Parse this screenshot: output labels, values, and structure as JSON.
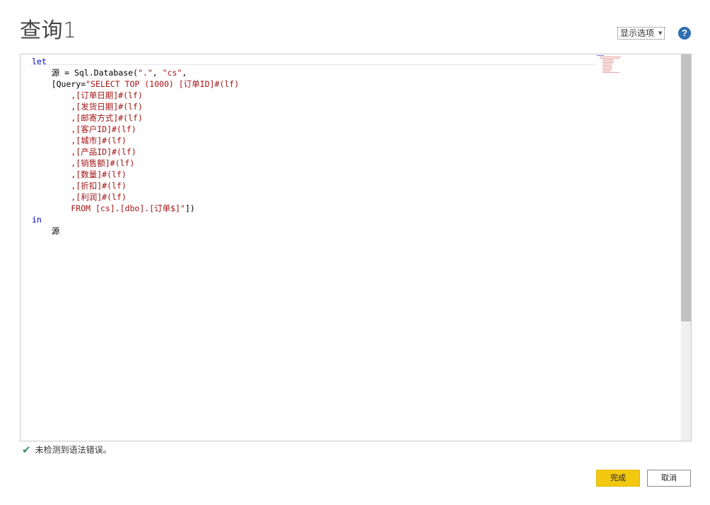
{
  "header": {
    "title": "查询1",
    "display_options_label": "显示选项",
    "display_options_caret": "▼",
    "help_glyph": "?"
  },
  "editor": {
    "lines": [
      [
        {
          "t": "let",
          "c": "kw"
        }
      ],
      [
        {
          "t": "    源 = Sql.Database(",
          "c": "ident"
        },
        {
          "t": "\".\"",
          "c": "str"
        },
        {
          "t": ", ",
          "c": "ident"
        },
        {
          "t": "\"cs\"",
          "c": "str"
        },
        {
          "t": ",",
          "c": "ident"
        }
      ],
      [
        {
          "t": "    [Query=",
          "c": "ident"
        },
        {
          "t": "\"SELECT TOP (1000) [订单ID]#(lf)",
          "c": "str"
        }
      ],
      [
        {
          "t": "        ,[订单日期]#(lf)",
          "c": "str"
        }
      ],
      [
        {
          "t": "        ,[发货日期]#(lf)",
          "c": "str"
        }
      ],
      [
        {
          "t": "        ,[邮寄方式]#(lf)",
          "c": "str"
        }
      ],
      [
        {
          "t": "        ,[客户ID]#(lf)",
          "c": "str"
        }
      ],
      [
        {
          "t": "        ,[城市]#(lf)",
          "c": "str"
        }
      ],
      [
        {
          "t": "        ,[产品ID]#(lf)",
          "c": "str"
        }
      ],
      [
        {
          "t": "        ,[销售额]#(lf)",
          "c": "str"
        }
      ],
      [
        {
          "t": "        ,[数量]#(lf)",
          "c": "str"
        }
      ],
      [
        {
          "t": "        ,[折扣]#(lf)",
          "c": "str"
        }
      ],
      [
        {
          "t": "        ,[利润]#(lf)",
          "c": "str"
        }
      ],
      [
        {
          "t": "        FROM [cs].[dbo].[订单$]\"",
          "c": "str"
        },
        {
          "t": "])",
          "c": "ident"
        }
      ],
      [
        {
          "t": "in",
          "c": "kw"
        }
      ],
      [
        {
          "t": "    源",
          "c": "ident"
        }
      ]
    ]
  },
  "status": {
    "icon": "✔",
    "message": "未检测到语法错误。"
  },
  "footer": {
    "done_label": "完成",
    "cancel_label": "取消"
  },
  "colors": {
    "accent": "#f2c811",
    "keyword": "#0000cc",
    "string": "#a31515",
    "success": "#3c8f64",
    "help": "#2f6fb5"
  }
}
